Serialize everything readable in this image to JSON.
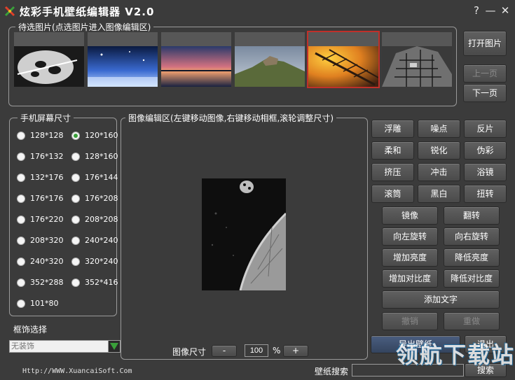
{
  "window": {
    "title": "炫彩手机壁纸编辑器 V2.0",
    "help_label": "?",
    "minimize_label": "—",
    "close_label": "✕"
  },
  "thumbnails": {
    "legend": "待选图片(点选图片进入图像编辑区)",
    "items": [
      {
        "name": "leaf-bw"
      },
      {
        "name": "blue-night"
      },
      {
        "name": "sunset-sea"
      },
      {
        "name": "cliff-ruins"
      },
      {
        "name": "orange-bridge",
        "selected": true
      },
      {
        "name": "bw-building"
      }
    ]
  },
  "nav": {
    "open_label": "打开图片",
    "prev_label": "上一页",
    "next_label": "下一页"
  },
  "screen_size": {
    "legend": "手机屏幕尺寸",
    "options": [
      "128*128",
      "120*160",
      "176*132",
      "128*160",
      "132*176",
      "176*144",
      "176*176",
      "176*208",
      "176*220",
      "208*208",
      "208*320",
      "240*240",
      "240*320",
      "320*240",
      "352*288",
      "352*416",
      "101*80"
    ],
    "selected": "120*160"
  },
  "frame": {
    "label": "框饰选择",
    "placeholder": "无装饰"
  },
  "editor": {
    "legend": "图像编辑区(左键移动图像,右键移动相框,滚轮调整尺寸)",
    "size_label": "图像尺寸",
    "minus_label": "-",
    "zoom_value": "100",
    "percent_label": "%",
    "plus_label": "+"
  },
  "effects": {
    "grid": [
      "浮雕",
      "噪点",
      "反片",
      "柔和",
      "锐化",
      "伪彩",
      "挤压",
      "冲击",
      "浴镜",
      "滚筒",
      "黑白",
      "扭转"
    ],
    "pairs": [
      [
        "镜像",
        "翻转"
      ],
      [
        "向左旋转",
        "向右旋转"
      ],
      [
        "增加亮度",
        "降低亮度"
      ],
      [
        "增加对比度",
        "降低对比度"
      ]
    ],
    "add_text_label": "添加文字",
    "undo_label": "撤销",
    "redo_label": "重做",
    "export_label": "导出壁纸",
    "exit_label": "退出"
  },
  "search": {
    "label": "壁纸搜索",
    "button_label": "搜索"
  },
  "footer": {
    "url": "Http://WWW.XuancaiSoft.Com",
    "watermark": "领航下载站"
  },
  "colors": {
    "background": "#3b3b3b",
    "selected_border": "#c0302a",
    "radio_check": "#3aa03a",
    "dropdown_arrow": "#3aa03a"
  }
}
